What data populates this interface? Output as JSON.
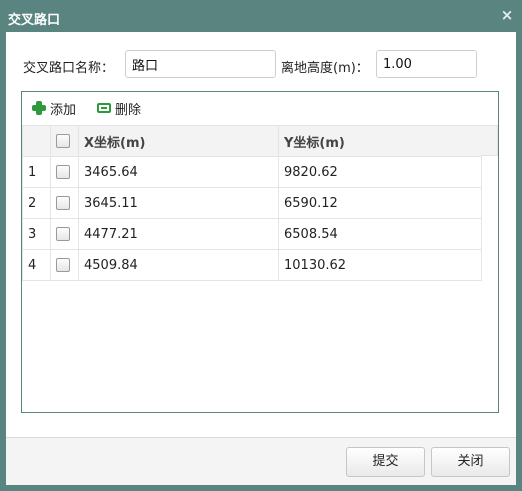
{
  "dialog": {
    "title": "交叉路口",
    "close_glyph": "×"
  },
  "form": {
    "name_label": "交叉路口名称：",
    "name_value": "路口",
    "height_label": "离地高度(m)：",
    "height_value": "1.00"
  },
  "toolbar": {
    "add_label": "添加",
    "delete_label": "删除"
  },
  "table": {
    "columns": [
      "X坐标(m)",
      "Y坐标(m)"
    ],
    "rows": [
      {
        "index": "1",
        "x": "3465.64",
        "y": "9820.62",
        "checked": false
      },
      {
        "index": "2",
        "x": "3645.11",
        "y": "6590.12",
        "checked": false
      },
      {
        "index": "3",
        "x": "4477.21",
        "y": "6508.54",
        "checked": false
      },
      {
        "index": "4",
        "x": "4509.84",
        "y": "10130.62",
        "checked": false
      }
    ]
  },
  "footer": {
    "submit_label": "提交",
    "close_label": "关闭"
  },
  "colors": {
    "frame": "#5a8480",
    "icon_green": "#2f9a3b"
  }
}
